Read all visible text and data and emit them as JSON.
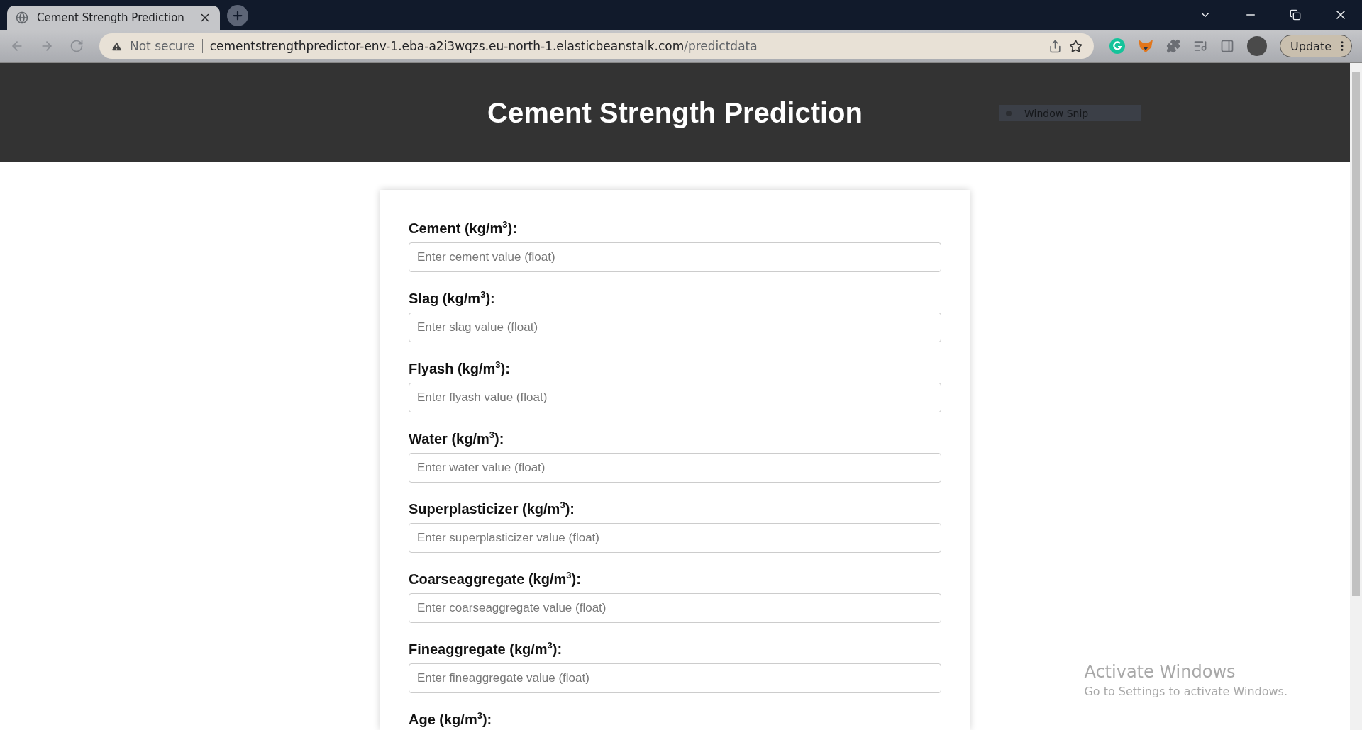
{
  "browser": {
    "tab": {
      "title": "Cement Strength Prediction",
      "selected": true
    },
    "security": "Not secure",
    "url_host": "cementstrengthpredictor-env-1.eba-a2i3wqzs.eu-north-1.elasticbeanstalk.com",
    "url_path": "/predictdata",
    "update_button": "Update"
  },
  "header": {
    "title": "Cement Strength Prediction"
  },
  "snip_overlay": {
    "label": "Window Snip"
  },
  "form": {
    "fields": [
      {
        "label": "Cement (kg/m$^{3}$):",
        "placeholder": "Enter cement value (float)"
      },
      {
        "label": "Slag (kg/m$^{3}$):",
        "placeholder": "Enter slag value (float)"
      },
      {
        "label": "Flyash (kg/m$^{3}$):",
        "placeholder": "Enter flyash value (float)"
      },
      {
        "label": "Water (kg/m$^{3}$):",
        "placeholder": "Enter water value (float)"
      },
      {
        "label": "Superplasticizer (kg/m$^{3}$):",
        "placeholder": "Enter superplasticizer value (float)"
      },
      {
        "label": "Coarseaggregate (kg/m$^{3}$):",
        "placeholder": "Enter coarseaggregate value (float)"
      },
      {
        "label": "Fineaggregate (kg/m$^{3}$):",
        "placeholder": "Enter fineaggregate value (float)"
      },
      {
        "label": "Age (kg/m$^{3}$):"
      }
    ]
  },
  "os_notice": {
    "title": "Activate Windows",
    "message": "Go to Settings to activate Windows."
  }
}
